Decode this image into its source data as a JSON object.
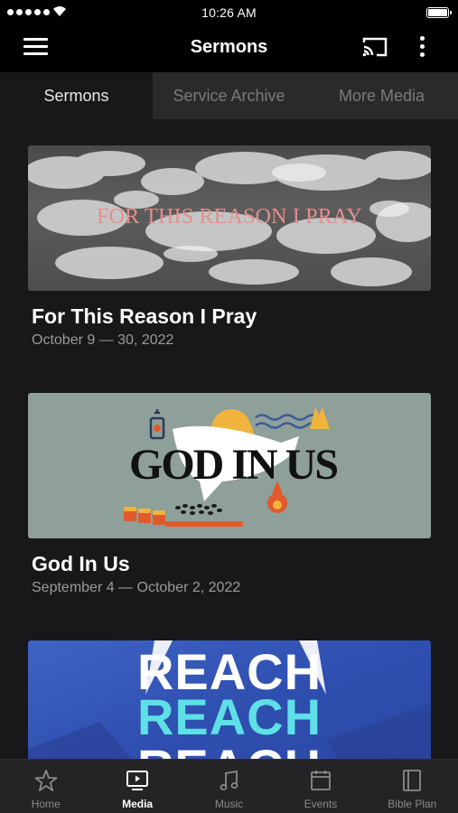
{
  "status_bar": {
    "time": "10:26 AM"
  },
  "header": {
    "title": "Sermons"
  },
  "tabs": [
    {
      "label": "Sermons",
      "active": true
    },
    {
      "label": "Service Archive",
      "active": false
    },
    {
      "label": "More Media",
      "active": false
    }
  ],
  "sermons": [
    {
      "title": "For This Reason I Pray",
      "dates": "October 9 — 30, 2022",
      "artwork_text": "FOR THIS REASON I PRAY"
    },
    {
      "title": "God In Us",
      "dates": "September 4 — October 2, 2022",
      "artwork_text": "GOD IN US"
    },
    {
      "artwork_lines": [
        "REACH",
        "REACH",
        "REACH"
      ]
    }
  ],
  "tab_bar": [
    {
      "label": "Home",
      "icon": "star-icon",
      "active": false
    },
    {
      "label": "Media",
      "icon": "tv-icon",
      "active": true
    },
    {
      "label": "Music",
      "icon": "music-note-icon",
      "active": false
    },
    {
      "label": "Events",
      "icon": "calendar-icon",
      "active": false
    },
    {
      "label": "Bible Plan",
      "icon": "book-icon",
      "active": false
    }
  ],
  "colors": {
    "background": "#18181a",
    "header": "#000000",
    "tabs_inactive": "#2a2a2b",
    "tab_bar": "#242426",
    "reach_accent": "#5ee0e6"
  }
}
